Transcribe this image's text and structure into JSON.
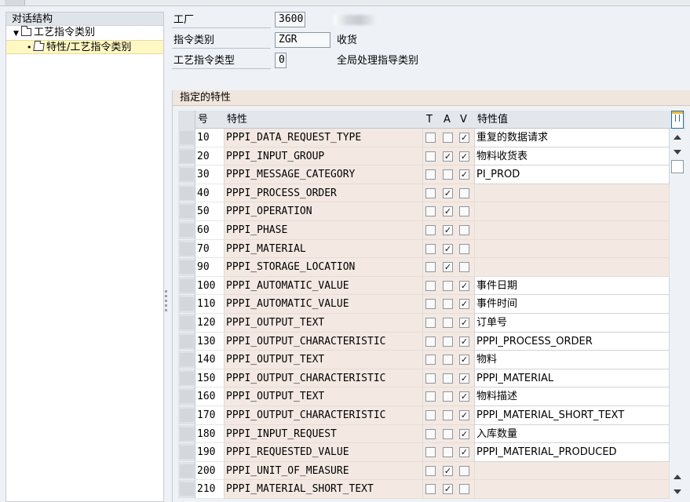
{
  "nav": {
    "title": "对话结构",
    "items": [
      {
        "label": "工艺指令类别",
        "expander": "▼"
      },
      {
        "label": "特性/工艺指令类别",
        "bullet": "•"
      }
    ]
  },
  "form": {
    "plant": {
      "label": "工厂",
      "value": "3600"
    },
    "category": {
      "label": "指令类别",
      "value": "ZGR",
      "desc": "收货"
    },
    "type": {
      "label": "工艺指令类型",
      "value": "0",
      "desc": "全局处理指导类别"
    }
  },
  "group": {
    "title": "指定的特性",
    "columns": {
      "no": "号",
      "char": "特性",
      "t": "T",
      "a": "A",
      "v": "V",
      "value": "特性值"
    },
    "rows": [
      {
        "no": "10",
        "char": "PPPI_DATA_REQUEST_TYPE",
        "t": "",
        "a": "",
        "v": "✓",
        "value": "重复的数据请求"
      },
      {
        "no": "20",
        "char": "PPPI_INPUT_GROUP",
        "t": "",
        "a": "✓",
        "v": "✓",
        "value": "物料收货表"
      },
      {
        "no": "30",
        "char": "PPPI_MESSAGE_CATEGORY",
        "t": "",
        "a": "",
        "v": "✓",
        "value": "PI_PROD"
      },
      {
        "no": "40",
        "char": "PPPI_PROCESS_ORDER",
        "t": "",
        "a": "✓",
        "v": "",
        "value": ""
      },
      {
        "no": "50",
        "char": "PPPI_OPERATION",
        "t": "",
        "a": "✓",
        "v": "",
        "value": ""
      },
      {
        "no": "60",
        "char": "PPPI_PHASE",
        "t": "",
        "a": "✓",
        "v": "",
        "value": ""
      },
      {
        "no": "70",
        "char": "PPPI_MATERIAL",
        "t": "",
        "a": "✓",
        "v": "",
        "value": ""
      },
      {
        "no": "90",
        "char": "PPPI_STORAGE_LOCATION",
        "t": "",
        "a": "✓",
        "v": "",
        "value": ""
      },
      {
        "no": "100",
        "char": "PPPI_AUTOMATIC_VALUE",
        "t": "",
        "a": "",
        "v": "✓",
        "value": "事件日期"
      },
      {
        "no": "110",
        "char": "PPPI_AUTOMATIC_VALUE",
        "t": "",
        "a": "",
        "v": "✓",
        "value": "事件时间"
      },
      {
        "no": "120",
        "char": "PPPI_OUTPUT_TEXT",
        "t": "",
        "a": "",
        "v": "✓",
        "value": "订单号"
      },
      {
        "no": "130",
        "char": "PPPI_OUTPUT_CHARACTERISTIC",
        "t": "",
        "a": "",
        "v": "✓",
        "value": "PPPI_PROCESS_ORDER"
      },
      {
        "no": "140",
        "char": "PPPI_OUTPUT_TEXT",
        "t": "",
        "a": "",
        "v": "✓",
        "value": "物料"
      },
      {
        "no": "150",
        "char": "PPPI_OUTPUT_CHARACTERISTIC",
        "t": "",
        "a": "",
        "v": "✓",
        "value": "PPPI_MATERIAL"
      },
      {
        "no": "160",
        "char": "PPPI_OUTPUT_TEXT",
        "t": "",
        "a": "",
        "v": "✓",
        "value": "物料描述"
      },
      {
        "no": "170",
        "char": "PPPI_OUTPUT_CHARACTERISTIC",
        "t": "",
        "a": "",
        "v": "✓",
        "value": "PPPI_MATERIAL_SHORT_TEXT"
      },
      {
        "no": "180",
        "char": "PPPI_INPUT_REQUEST",
        "t": "",
        "a": "",
        "v": "✓",
        "value": "入库数量"
      },
      {
        "no": "190",
        "char": "PPPI_REQUESTED_VALUE",
        "t": "",
        "a": "",
        "v": "✓",
        "value": "PPPI_MATERIAL_PRODUCED"
      },
      {
        "no": "200",
        "char": "PPPI_UNIT_OF_MEASURE",
        "t": "",
        "a": "✓",
        "v": "",
        "value": ""
      },
      {
        "no": "210",
        "char": "PPPI_MATERIAL_SHORT_TEXT",
        "t": "",
        "a": "✓",
        "v": "",
        "value": ""
      }
    ]
  },
  "icons": {
    "settings": "table-settings-icon",
    "scroll_up": "scroll-up-icon",
    "scroll_down": "scroll-down-icon"
  },
  "colors": {
    "input_bg": "#f3e9e2",
    "selected_nav": "#fff8c4",
    "frame_bg": "#eef2f6"
  }
}
